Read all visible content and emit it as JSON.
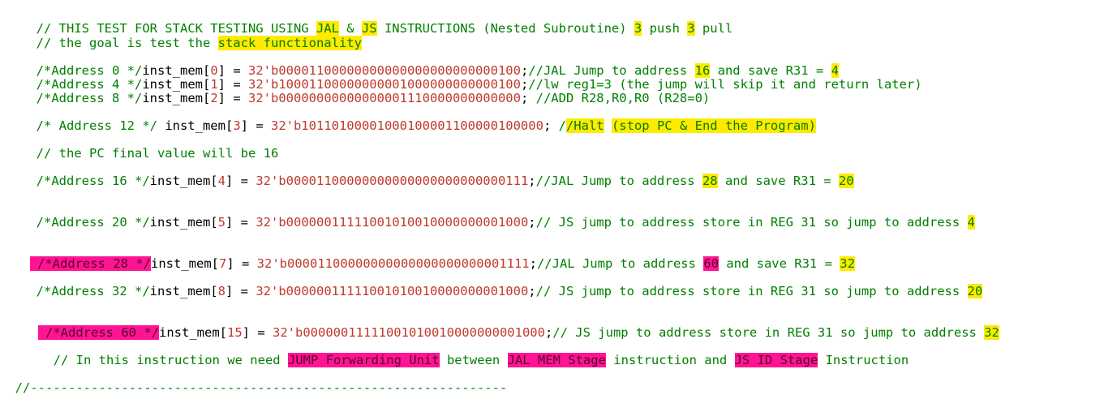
{
  "colors": {
    "comment": "#008000",
    "number": "#c0392b",
    "text": "#000000",
    "highlight_yellow": "#ffea00",
    "highlight_magenta": "#ff1493"
  },
  "lines": {
    "l1": {
      "a": "// THIS TEST FOR STACK TESTING USING ",
      "b": "JAL",
      "c": " & ",
      "d": "JS",
      "e": " INSTRUCTIONS (Nested Subroutine) ",
      "f": "3",
      "g": " push ",
      "h": "3",
      "i": " pull"
    },
    "l2": {
      "a": "// the goal is test the ",
      "b": "stack functionality"
    },
    "l3": {
      "a": "/*Address 0 */",
      "b": "inst_mem[",
      "c": "0",
      "d": "] = ",
      "e": "32'b00001100000000000000000000000100",
      "f": ";",
      "g": "//JAL Jump to address ",
      "h": "16",
      "i": " and save R31 = ",
      "j": "4"
    },
    "l4": {
      "a": "/*Address 4 */",
      "b": "inst_mem[",
      "c": "1",
      "d": "] = ",
      "e": "32'b10001100000000001000000000000100",
      "f": ";",
      "g": "//lw reg1=3 (the jump will skip it and return later)"
    },
    "l5": {
      "a": "/*Address 8 */",
      "b": "inst_mem[",
      "c": "2",
      "d": "] = ",
      "e": "32'b00000000000000001110000000000000",
      "f": "; ",
      "g": "//ADD R28,R0,R0 (R28=0)"
    },
    "l6": {
      "a": "/* Address 12 */",
      "b": " inst_mem[",
      "c": "3",
      "d": "] = ",
      "e": "32'b10110100001000100001100000100000",
      "f": "; ",
      "g": "/",
      "h": "/Halt",
      "i": " ",
      "j": "(stop PC & End the Program)"
    },
    "l7": {
      "a": "// the PC final value will be 16"
    },
    "l8": {
      "a": "/*Address 16 */",
      "b": "inst_mem[",
      "c": "4",
      "d": "] = ",
      "e": "32'b00001100000000000000000000000111",
      "f": ";",
      "g": "//JAL Jump to address ",
      "h": "28",
      "i": " and save R31 = ",
      "j": "20"
    },
    "l9": {
      "a": "/*Address 20 */",
      "b": "inst_mem[",
      "c": "5",
      "d": "] = ",
      "e": "32'b00000011111001010010000000001000",
      "f": ";",
      "g": "// JS jump to address store in REG 31 so jump to address ",
      "h": "4"
    },
    "l10": {
      "a": "/*Address 28 */",
      "b": "inst_mem[",
      "c": "7",
      "d": "] = ",
      "e": "32'b00001100000000000000000000001111",
      "f": ";",
      "g": "//JAL Jump to address ",
      "h": "60",
      "i": " and save R31 = ",
      "j": "32"
    },
    "l11": {
      "a": "/*Address 32 */",
      "b": "inst_mem[",
      "c": "8",
      "d": "] = ",
      "e": "32'b00000011111001010010000000001000",
      "f": ";",
      "g": "// JS jump to address store in REG 31 so jump to address ",
      "h": "20"
    },
    "l12": {
      "a": "/*Address 60 */",
      "b": "inst_mem[",
      "c": "15",
      "d": "] = ",
      "e": "32'b00000011111001010010000000001000",
      "f": ";",
      "g": "// JS jump to address store in REG 31 so jump to address ",
      "h": "32"
    },
    "l13": {
      "a": "// In this instruction we need ",
      "b": "JUMP Forwarding Unit",
      "c": " between ",
      "d": "JAL MEM Stage",
      "e": " instruction and ",
      "f": "JS ID Stage",
      "g": " Instruction"
    },
    "l14": {
      "a": "//---------------------------------------------------------------"
    }
  }
}
